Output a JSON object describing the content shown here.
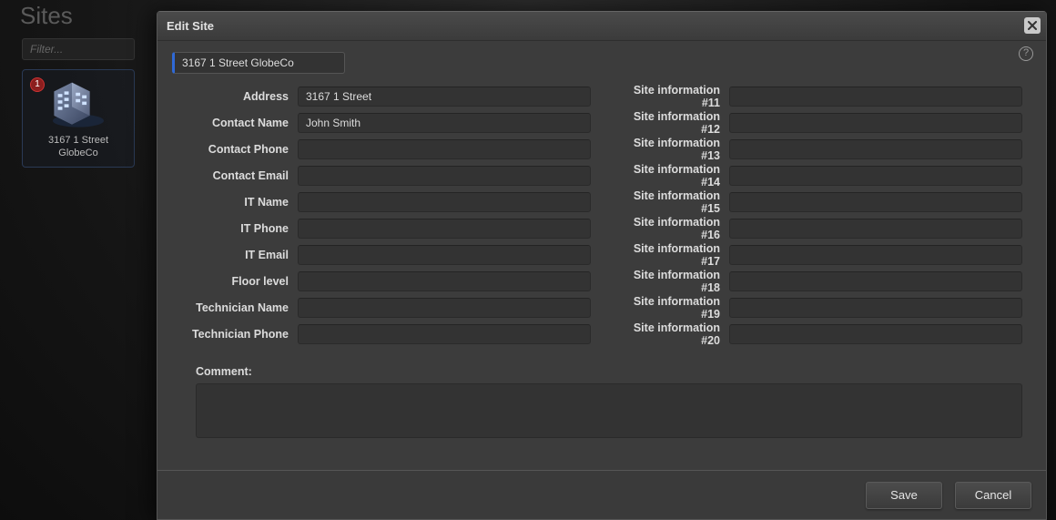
{
  "page": {
    "title": "Sites",
    "filter_placeholder": "Filter..."
  },
  "site_card": {
    "badge": "1",
    "name_line1": "3167 1 Street",
    "name_line2": "GlobeCo"
  },
  "modal": {
    "title": "Edit Site",
    "help": "?",
    "site_name": "3167 1 Street GlobeCo",
    "left_fields": [
      {
        "label": "Address",
        "value": "3167 1 Street"
      },
      {
        "label": "Contact Name",
        "value": "John Smith"
      },
      {
        "label": "Contact Phone",
        "value": ""
      },
      {
        "label": "Contact Email",
        "value": ""
      },
      {
        "label": "IT Name",
        "value": ""
      },
      {
        "label": "IT Phone",
        "value": ""
      },
      {
        "label": "IT Email",
        "value": ""
      },
      {
        "label": "Floor level",
        "value": ""
      },
      {
        "label": "Technician Name",
        "value": ""
      },
      {
        "label": "Technician Phone",
        "value": ""
      }
    ],
    "right_fields": [
      {
        "label": "Site information #11",
        "value": ""
      },
      {
        "label": "Site information #12",
        "value": ""
      },
      {
        "label": "Site information #13",
        "value": ""
      },
      {
        "label": "Site information #14",
        "value": ""
      },
      {
        "label": "Site information #15",
        "value": ""
      },
      {
        "label": "Site information #16",
        "value": ""
      },
      {
        "label": "Site information #17",
        "value": ""
      },
      {
        "label": "Site information #18",
        "value": ""
      },
      {
        "label": "Site information #19",
        "value": ""
      },
      {
        "label": "Site information #20",
        "value": ""
      }
    ],
    "comment_label": "Comment:",
    "comment_value": "",
    "save_label": "Save",
    "cancel_label": "Cancel"
  }
}
